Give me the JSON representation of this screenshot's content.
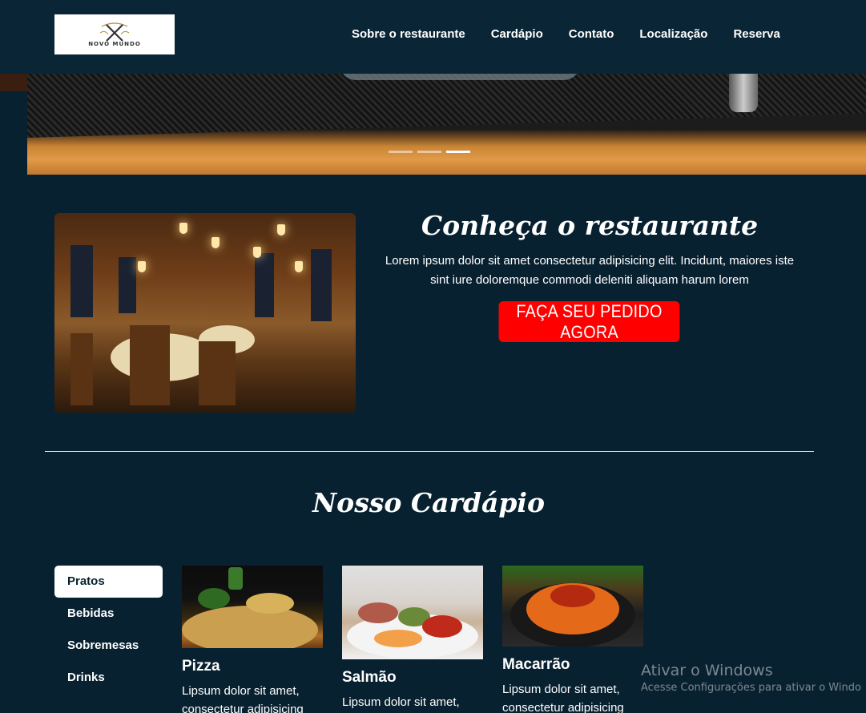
{
  "navbar": {
    "logo_text": "NOVO MUNDO",
    "links": [
      "Sobre o restaurante",
      "Cardápio",
      "Contato",
      "Localização",
      "Reserva"
    ]
  },
  "carousel": {
    "slide_count": 3,
    "active_index": 2
  },
  "about": {
    "title": "Conheça o restaurante",
    "text": "Lorem ipsum dolor sit amet consectetur adipisicing elit. Incidunt, maiores iste sint iure doloremque commodi deleniti aliquam harum lorem",
    "button_label": "FAÇA SEU PEDIDO AGORA"
  },
  "menu": {
    "title": "Nosso Cardápio",
    "tabs": [
      "Pratos",
      "Bebidas",
      "Sobremesas",
      "Drinks"
    ],
    "active_tab": "Pratos",
    "items": [
      {
        "name": "Pizza",
        "desc": "Lipsum dolor sit amet, consectetur adipisicing"
      },
      {
        "name": "Salmão",
        "desc": "Lipsum dolor sit amet,"
      },
      {
        "name": "Macarrão",
        "desc": "Lipsum dolor sit amet, consectetur adipisicing"
      }
    ]
  },
  "watermark": {
    "title": "Ativar o Windows",
    "subtitle": "Acesse Configurações para ativar o Windo"
  },
  "colors": {
    "background": "#082130",
    "cta": "#ff0000",
    "text": "#ffffff"
  }
}
